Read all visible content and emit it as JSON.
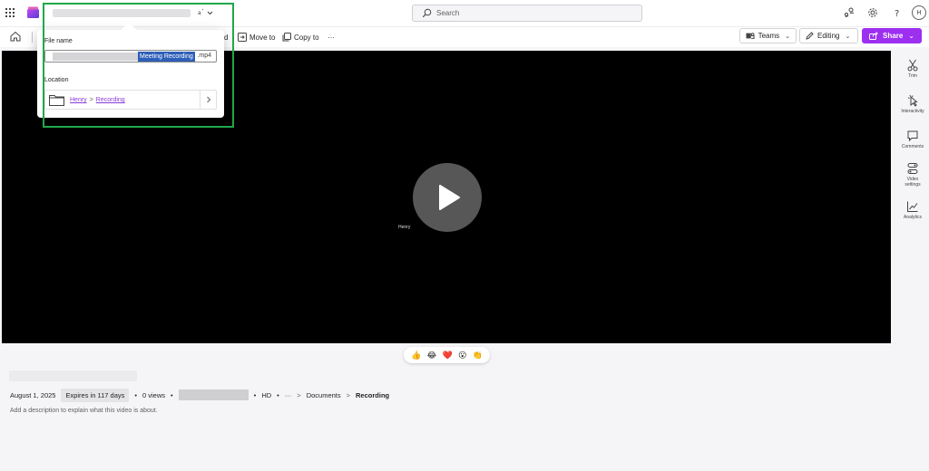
{
  "header": {
    "search_placeholder": "Search",
    "avatar_initial": "H"
  },
  "commandbar": {
    "partial_item": "d",
    "move_to": "Move to",
    "copy_to": "Copy to",
    "more": "···",
    "teams": "Teams",
    "editing": "Editing",
    "share": "Share",
    "share_color": "#9c2ff0"
  },
  "video": {
    "overlay_name": "Henry"
  },
  "rail": {
    "trim": "Trim",
    "interactivity": "Interactivity",
    "comments": "Comments",
    "video_settings_1": "Video",
    "video_settings_2": "settings",
    "analytics": "Analytics"
  },
  "reactions": [
    "👍",
    "😂",
    "❤️",
    "😮",
    "👏"
  ],
  "meta": {
    "date": "August 1, 2025",
    "expires": "Expires in 117 days",
    "dot": "•",
    "views": "0 views",
    "quality": "HD",
    "more": "···",
    "chevron": ">",
    "folder": "Documents",
    "current": "Recording",
    "description": "Add a description to explain what this video is about."
  },
  "popup": {
    "file_name_label": "File name",
    "file_name_selected": "Meeting Recording",
    "file_extension": ".mp4",
    "location_label": "Location",
    "location_root": "Henry",
    "location_folder": "Recording",
    "separator": ">"
  }
}
